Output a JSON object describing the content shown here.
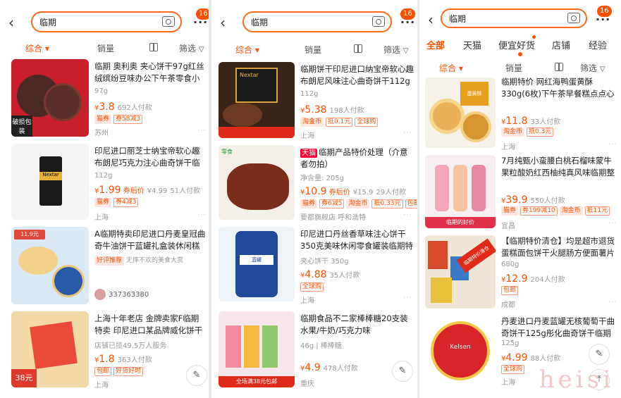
{
  "panels": [
    {
      "search_query": "临期",
      "more_badge": "16",
      "filters": [
        "综合",
        "销量",
        "筛选"
      ],
      "items": [
        {
          "title": "临期 奥利奥 夹心饼干97g红丝绒缤纷豆味办公下午茶零食小吃",
          "spec": "97g",
          "price": "3.8",
          "note": "692人付款",
          "tags": [
            "猫券",
            "券58减3"
          ],
          "shop": "苏州",
          "thumb_text": "破损包装"
        },
        {
          "title": "印尼进口丽芝士纳宝帝软心趣布朗尼巧克力注心曲奇饼干临期零",
          "spec": "112g",
          "price": "1.99",
          "orig": "¥4.99",
          "price_tag": "券后价",
          "note": "51人付款",
          "tags": [
            "猫券",
            "券4减3"
          ],
          "shop": "上海",
          "thumb_text": "Nextar"
        },
        {
          "title": "A临期特卖印尼进口丹麦皇冠曲奇牛油饼干蓝罐礼盒装休闲糕点",
          "spec": "",
          "price": "",
          "note": "",
          "tags": [
            "好评推荐",
            "无摔不欢的美食大赏"
          ],
          "shop": "337363380",
          "thumb_text": "11.9元"
        },
        {
          "title": "上海十年老店 金牌卖家F临期特卖 印尼进口某品牌威化饼干巧克",
          "spec": "店铺已揽49.5万人服务",
          "price": "1.8",
          "note": "363人付款",
          "tags": [
            "包邮",
            "好货好时"
          ],
          "shop": "上海",
          "thumb_text": "38元"
        }
      ]
    },
    {
      "search_query": "临期",
      "more_badge": "16",
      "filters": [
        "综合",
        "销量",
        "筛选"
      ],
      "items": [
        {
          "title": "临期饼干印尼进口纳宝帝软心趣布朗尼风味注心曲奇饼干112g小",
          "spec": "112g",
          "price": "5.38",
          "note": "198人付款",
          "tags": [
            "淘金币",
            "抵0.1元",
            "全球购"
          ],
          "shop": "上海",
          "thumb_text": "Nextar"
        },
        {
          "title": "临期产品特价处理（介意者勿拍）",
          "brand": "天猫",
          "spec": "净含量: 205g",
          "price": "10.9",
          "orig": "¥15.9",
          "price_tag": "券后价",
          "note": "29人付款",
          "tags": [
            "猫券",
            "券6减5",
            "淘金币",
            "抵0.33元",
            "包邮"
          ],
          "shop": "要都旗舰店 呼和浩特",
          "thumb_text": "零食"
        },
        {
          "title": "印尼进口丹丝香草味注心饼干350克美味休闲零食罐装临期特价",
          "spec": "夹心饼干  350g",
          "price": "4.88",
          "note": "35人付款",
          "tags": [
            "全球购"
          ],
          "shop": "上海",
          "thumb_text": "蓝罐"
        },
        {
          "title": "临期食品不二家棒棒糖20支装水果/牛奶/巧克力味125g/116g",
          "spec": "46g | 棒棒糖",
          "price": "4.9",
          "note": "478人付款",
          "tags": [],
          "shop": "重庆",
          "thumb_text": "全场满38元包邮"
        }
      ]
    },
    {
      "search_query": "临期",
      "more_badge": "16",
      "tabs": [
        "全部",
        "天猫",
        "便宜好货",
        "店铺",
        "经验"
      ],
      "filters": [
        "综合",
        "销量",
        "筛选"
      ],
      "items": [
        {
          "title": "临期特价 网红海鸭蛋黄酥330g(6枚)下午茶早餐糕点点心酥饼月",
          "spec": "",
          "price": "11.8",
          "note": "33人付款",
          "tags": [
            "淘金币",
            "抵0.3元"
          ],
          "shop": "上海",
          "thumb_text": "蛋黄酥"
        },
        {
          "title": "7月纯甄小蛮腰白桃石榴味蒙牛果粒酸奶红西柚纯真风味临期整",
          "spec": "",
          "price": "39.9",
          "note": "550人付款",
          "tags": [
            "猫券",
            "券199减10",
            "淘金币",
            "抵11元"
          ],
          "shop": "宜昌",
          "thumb_text": "临期的好价"
        },
        {
          "title": "【临期特价清仓】均是超市退货蛋糕面包饼干火腿肠方便面薯片",
          "spec": "680g",
          "price": "12.9",
          "note": "204人付款",
          "tags": [
            "包邮"
          ],
          "shop": "成都",
          "thumb_text": "临期特价清仓"
        },
        {
          "title": "丹麦进口丹麦蓝罐无核葡萄干曲奇饼干125g彤化曲奇饼干临期特",
          "spec": "125g",
          "price": "4.99",
          "note": "88人付款",
          "tags": [
            "全球购"
          ],
          "shop": "上海",
          "thumb_text": "Kelsen"
        }
      ]
    }
  ],
  "watermark": "heisi",
  "colors": {
    "accent": "#ff5000",
    "bg": "#e8e8e8"
  }
}
